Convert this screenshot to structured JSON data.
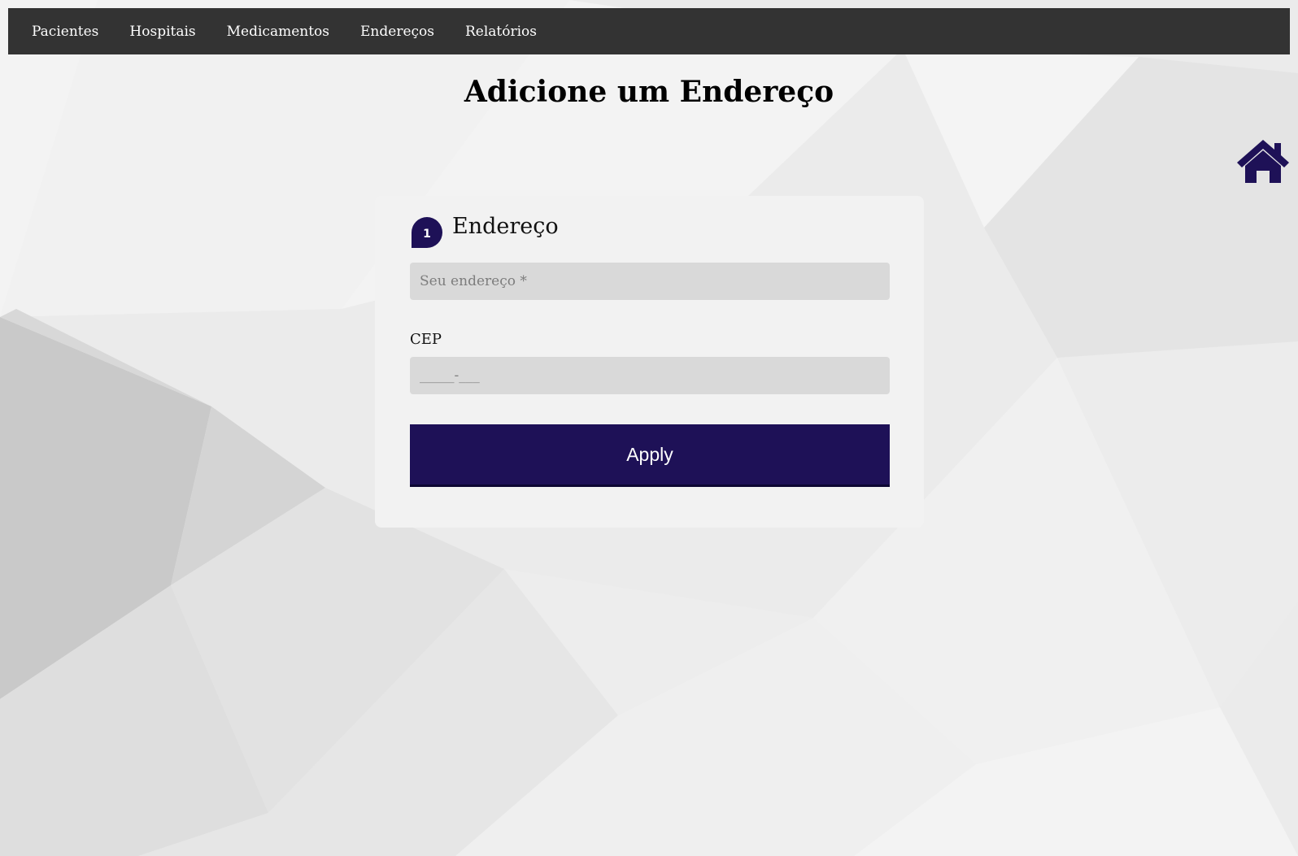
{
  "nav": {
    "items": [
      {
        "label": "Pacientes"
      },
      {
        "label": "Hospitais"
      },
      {
        "label": "Medicamentos"
      },
      {
        "label": "Endereços"
      },
      {
        "label": "Relatórios"
      }
    ]
  },
  "page": {
    "title": "Adicione um Endereço"
  },
  "form": {
    "step_number": "1",
    "section_title": "Endereço",
    "address_placeholder": "Seu endereço *",
    "address_value": "",
    "cep_label": "CEP",
    "cep_placeholder": "_____-___",
    "cep_value": "",
    "apply_label": "Apply"
  },
  "colors": {
    "navbar": "#333333",
    "accent": "#1e1157",
    "card": "#f2f2f2",
    "input_bg": "#d9d9d9"
  },
  "icons": {
    "home": "home-icon"
  }
}
